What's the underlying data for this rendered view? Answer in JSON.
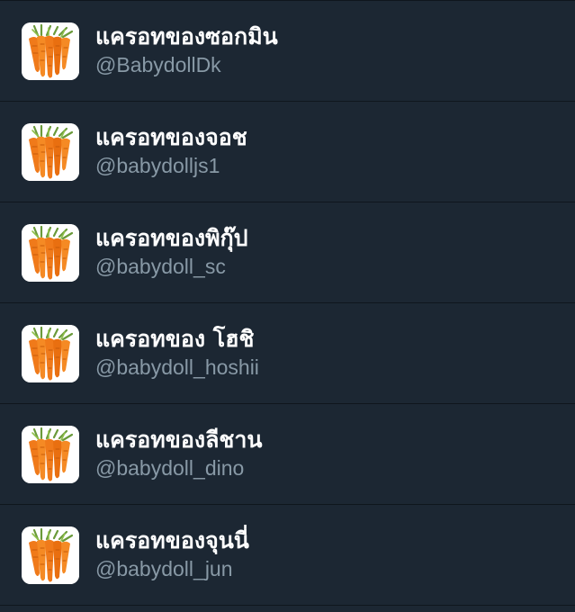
{
  "accounts": [
    {
      "name": "แครอทของซอกมิน",
      "handle": "@BabydollDk",
      "avatar_icon": "carrot-icon"
    },
    {
      "name": "แครอทของจอช",
      "handle": "@babydolljs1",
      "avatar_icon": "carrot-icon"
    },
    {
      "name": "แครอทของพิกุ๊ป",
      "handle": "@babydoll_sc",
      "avatar_icon": "carrot-icon"
    },
    {
      "name": "แครอทของ โฮชิ",
      "handle": "@babydoll_hoshii",
      "avatar_icon": "carrot-icon"
    },
    {
      "name": "แครอทของลีชาน",
      "handle": "@babydoll_dino",
      "avatar_icon": "carrot-icon"
    },
    {
      "name": "แครอทของจุนนี่",
      "handle": "@babydoll_jun",
      "avatar_icon": "carrot-icon"
    }
  ],
  "colors": {
    "background": "#1c2733",
    "divider": "#0f161d",
    "name_text": "#ffffff",
    "handle_text": "#8899a6",
    "carrot": "#f07a1a",
    "leaf": "#6a9a3a"
  }
}
